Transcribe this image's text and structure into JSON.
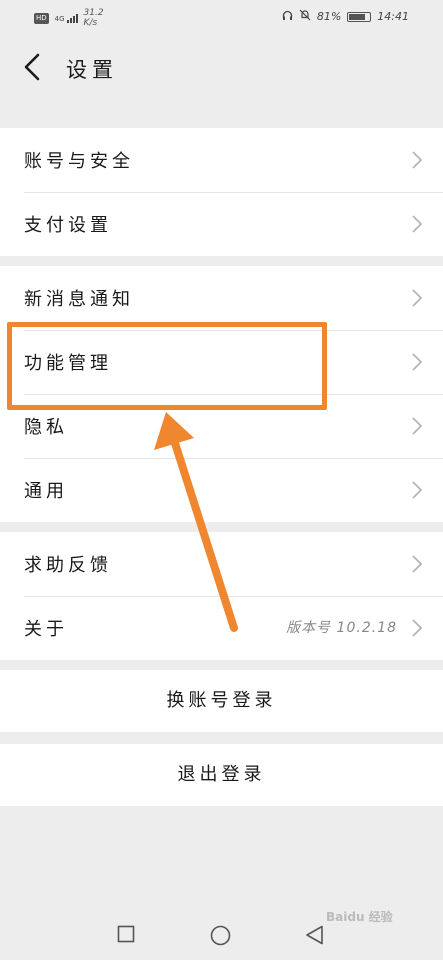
{
  "status_bar": {
    "hd": "HD",
    "signal": "4G",
    "net_speed_value": "31.2",
    "net_speed_unit": "K/s",
    "battery_percent": "81%",
    "time": "14:41"
  },
  "header": {
    "title": "设置"
  },
  "groups": [
    {
      "items": [
        {
          "label": "账号与安全"
        },
        {
          "label": "支付设置"
        }
      ]
    },
    {
      "items": [
        {
          "label": "新消息通知"
        },
        {
          "label": "功能管理"
        },
        {
          "label": "隐私"
        },
        {
          "label": "通用"
        }
      ]
    },
    {
      "items": [
        {
          "label": "求助反馈"
        },
        {
          "label": "关于",
          "value": "版本号 10.2.18"
        }
      ]
    }
  ],
  "actions": {
    "switch_account": "换账号登录",
    "logout": "退出登录"
  },
  "watermark": "Baidu 经验",
  "colors": {
    "highlight": "#f0862e",
    "background": "#ededed"
  }
}
